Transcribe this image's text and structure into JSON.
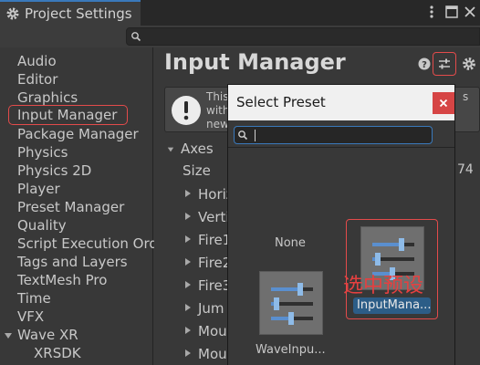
{
  "window": {
    "tab_label": "Project Settings",
    "search_placeholder": ""
  },
  "sidebar": {
    "items": [
      {
        "label": "Audio"
      },
      {
        "label": "Editor"
      },
      {
        "label": "Graphics"
      },
      {
        "label": "Input Manager",
        "selected": true
      },
      {
        "label": "Package Manager"
      },
      {
        "label": "Physics"
      },
      {
        "label": "Physics 2D"
      },
      {
        "label": "Player"
      },
      {
        "label": "Preset Manager"
      },
      {
        "label": "Quality"
      },
      {
        "label": "Script Execution Ord"
      },
      {
        "label": "Tags and Layers"
      },
      {
        "label": "TextMesh Pro"
      },
      {
        "label": "Time"
      },
      {
        "label": "VFX"
      },
      {
        "label": "Wave XR"
      },
      {
        "label": "XRSDK"
      }
    ]
  },
  "main": {
    "title": "Input Manager",
    "info_lines": [
      "This",
      "with",
      "new"
    ],
    "info_right": "s",
    "axes_label": "Axes",
    "size_label": "Size",
    "size_value": "74",
    "axis_items": [
      "Horiz",
      "Verti",
      "Fire1",
      "Fire2",
      "Fire3",
      "Jum",
      "Mou",
      "Mou"
    ]
  },
  "dialog": {
    "title": "Select Preset",
    "search_value": "",
    "none_label": "None",
    "presets": [
      {
        "name": "InputMana...",
        "selected": true
      },
      {
        "name": "WaveInpu...",
        "selected": false
      }
    ],
    "annotation": "选中预设"
  },
  "colors": {
    "accent_blue": "#3a79bb",
    "highlight_red": "#e34b4b",
    "selection_blue": "#2c5d87",
    "background": "#383838"
  }
}
